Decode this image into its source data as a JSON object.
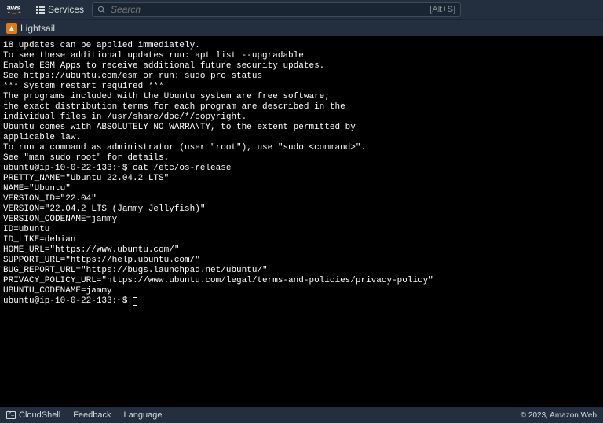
{
  "header": {
    "logo_text": "aws",
    "services_label": "Services",
    "search_placeholder": "Search",
    "search_shortcut": "[Alt+S]"
  },
  "subheader": {
    "service_name": "Lightsail"
  },
  "terminal": {
    "lines": [
      "18 updates can be applied immediately.",
      "To see these additional updates run: apt list --upgradable",
      "",
      "Enable ESM Apps to receive additional future security updates.",
      "See https://ubuntu.com/esm or run: sudo pro status",
      "",
      "",
      "*** System restart required ***",
      "",
      "The programs included with the Ubuntu system are free software;",
      "the exact distribution terms for each program are described in the",
      "individual files in /usr/share/doc/*/copyright.",
      "",
      "Ubuntu comes with ABSOLUTELY NO WARRANTY, to the extent permitted by",
      "applicable law.",
      "",
      "To run a command as administrator (user \"root\"), use \"sudo <command>\".",
      "See \"man sudo_root\" for details.",
      "",
      "ubuntu@ip-10-0-22-133:~$ cat /etc/os-release",
      "PRETTY_NAME=\"Ubuntu 22.04.2 LTS\"",
      "NAME=\"Ubuntu\"",
      "VERSION_ID=\"22.04\"",
      "VERSION=\"22.04.2 LTS (Jammy Jellyfish)\"",
      "VERSION_CODENAME=jammy",
      "ID=ubuntu",
      "ID_LIKE=debian",
      "HOME_URL=\"https://www.ubuntu.com/\"",
      "SUPPORT_URL=\"https://help.ubuntu.com/\"",
      "BUG_REPORT_URL=\"https://bugs.launchpad.net/ubuntu/\"",
      "PRIVACY_POLICY_URL=\"https://www.ubuntu.com/legal/terms-and-policies/privacy-policy\"",
      "UBUNTU_CODENAME=jammy"
    ],
    "prompt": "ubuntu@ip-10-0-22-133:~$ "
  },
  "footer": {
    "cloudshell": "CloudShell",
    "feedback": "Feedback",
    "language": "Language",
    "copyright": "© 2023, Amazon Web"
  }
}
